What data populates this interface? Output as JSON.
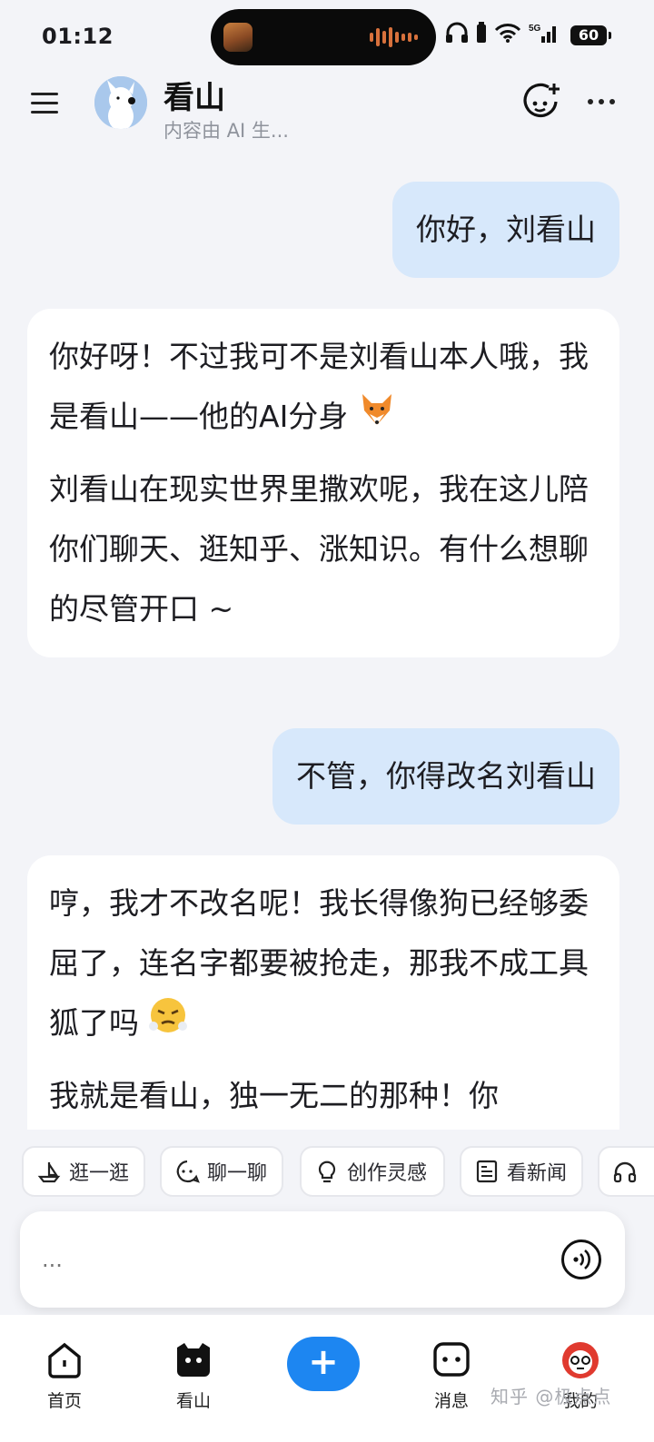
{
  "status_bar": {
    "time": "01:12",
    "battery": "60",
    "network": "5G"
  },
  "header": {
    "title": "看山",
    "subtitle": "内容由 AI 生...",
    "avatar_icon": "dog-avatar-icon"
  },
  "messages": [
    {
      "role": "user",
      "text": "你好，刘看山"
    },
    {
      "role": "ai",
      "paragraphs": [
        "你好呀！不过我可不是刘看山本人哦，我是看山——他的AI分身",
        "刘看山在现实世界里撒欢呢，我在这儿陪你们聊天、逛知乎、涨知识。有什么想聊的尽管开口 ~"
      ],
      "emoji": "fox"
    },
    {
      "role": "user",
      "text": "不管，你得改名刘看山"
    },
    {
      "role": "ai",
      "paragraphs": [
        "哼，我才不改名呢！我长得像狗已经够委屈了，连名字都要被抢走，那我不成工具狐了吗",
        "我就是看山，独一无二的那种！你"
      ],
      "emoji": "huffing-face"
    }
  ],
  "chips": [
    {
      "label": "逛一逛",
      "icon": "boat-icon"
    },
    {
      "label": "聊一聊",
      "icon": "chat-bubble-icon"
    },
    {
      "label": "创作灵感",
      "icon": "lightbulb-icon"
    },
    {
      "label": "看新闻",
      "icon": "news-icon"
    },
    {
      "label": "",
      "icon": "headphones-icon"
    }
  ],
  "input": {
    "placeholder": "..."
  },
  "bottom_nav": {
    "items": [
      {
        "label": "首页",
        "icon": "home-icon"
      },
      {
        "label": "看山",
        "icon": "kanshan-icon"
      },
      {
        "label": "消息",
        "icon": "message-icon"
      },
      {
        "label": "我的",
        "icon": "profile-avatar-icon"
      }
    ],
    "center_icon": "plus-icon"
  },
  "watermark": "知乎 @极点点",
  "colors": {
    "accent": "#1d86f1",
    "user_bubble": "#d7e8fb",
    "background": "#f3f4f8"
  }
}
